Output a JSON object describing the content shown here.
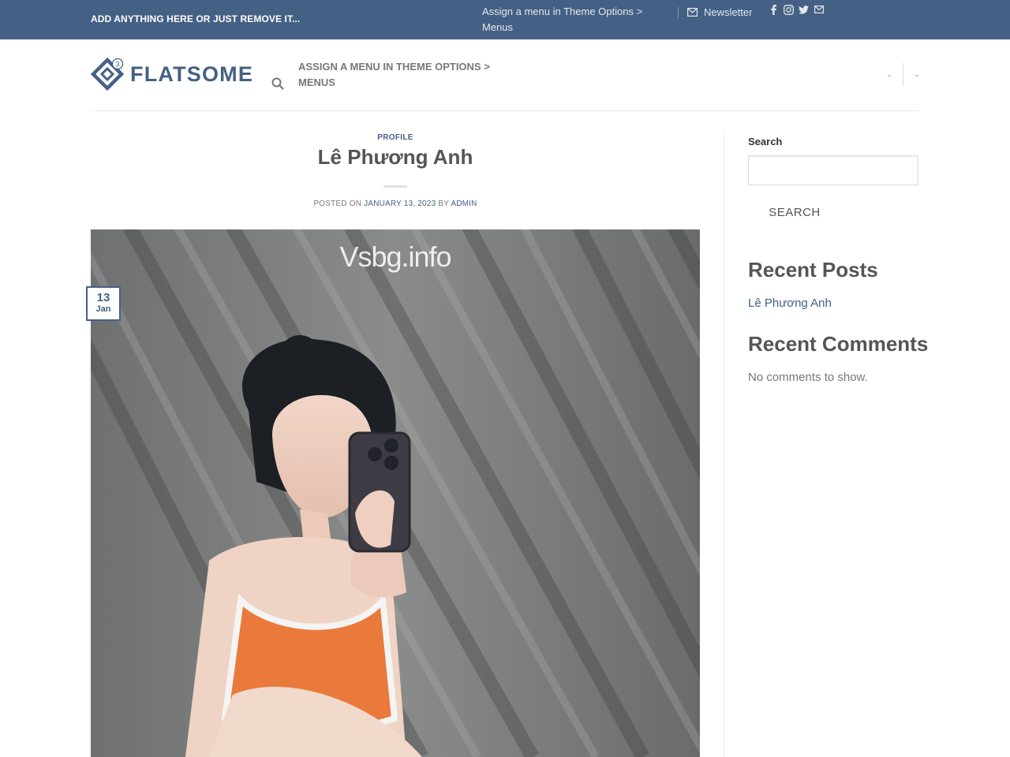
{
  "topbar": {
    "left_text": "ADD ANYTHING HERE OR JUST REMOVE IT...",
    "menu_text_line1": "Assign a menu in Theme Options >",
    "menu_text_line2": "Menus",
    "newsletter_label": "Newsletter",
    "social_icons": [
      "facebook-icon",
      "instagram-icon",
      "twitter-icon",
      "envelope-icon"
    ]
  },
  "header": {
    "logo_text": "FLATSOME",
    "logo_badge": "3",
    "menu_text_line1": "ASSIGN A MENU IN THEME OPTIONS >",
    "menu_text_line2": "MENUS",
    "right_item_1": "-",
    "right_item_2": "-"
  },
  "post": {
    "category": "PROFILE",
    "title": "Lê Phương Anh",
    "posted_on_label": "POSTED ON",
    "date": "JANUARY 13, 2023",
    "by_label": "BY",
    "author": "ADMIN",
    "watermark": "Vsbg.info",
    "badge_day": "13",
    "badge_month": "Jan"
  },
  "sidebar": {
    "search_label": "Search",
    "search_value": "",
    "search_button": "SEARCH",
    "recent_posts_heading": "Recent Posts",
    "recent_post_1": "Lê Phương Anh",
    "recent_comments_heading": "Recent Comments",
    "no_comments_text": "No comments to show."
  },
  "colors": {
    "primary": "#446084",
    "text": "#555555",
    "border": "#ececec"
  }
}
